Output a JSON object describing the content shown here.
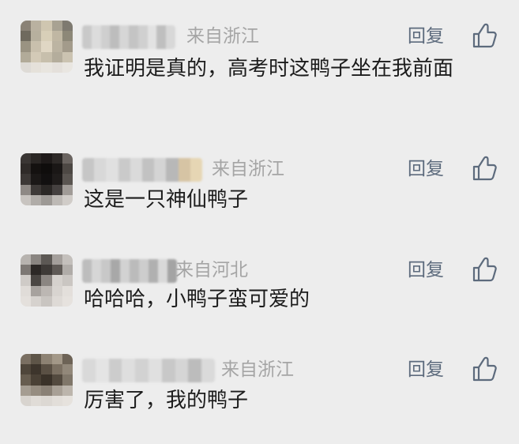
{
  "comments": [
    {
      "location": "来自浙江",
      "reply_label": "回复",
      "text": "我证明是真的，高考时这鸭子坐在我前面",
      "avatar_colors": [
        "#8a8276",
        "#b9b1a0",
        "#cfc6b0",
        "#a8a292",
        "#7e7a70",
        "#6f6a5e",
        "#b7b09e",
        "#d8cfb8",
        "#c0b7a3",
        "#8d8878",
        "#9a9382",
        "#c9c0ad",
        "#e0d7c4",
        "#bcb4a2",
        "#a39b8b",
        "#b2ab99",
        "#d3cab7",
        "#c7bfac",
        "#b4ad9c",
        "#cbc3b1",
        "#dedbd6",
        "#e5e1da",
        "#e8e5df",
        "#e4e0db",
        "#e9e6e1"
      ],
      "name_colors": [
        "#c9c9c9",
        "#dcdcdc",
        "#cfcfcf",
        "#bdbdbd",
        "#d6d6d6",
        "#c4c4c4",
        "#d0d0d0",
        "#e2e2e2",
        "#bfbfbf",
        "#d8d8d8"
      ]
    },
    {
      "location": "来自浙江",
      "reply_label": "回复",
      "text": "这是一只神仙鸭子",
      "avatar_colors": [
        "#3a3634",
        "#2a2624",
        "#1e1a19",
        "#2d2927",
        "#6a6460",
        "#2f2b29",
        "#141110",
        "#0f0d0c",
        "#1a1716",
        "#4d4844",
        "#3c3836",
        "#1b1817",
        "#121010",
        "#1f1c1b",
        "#5a5551",
        "#8e8985",
        "#3e3a38",
        "#2b2826",
        "#454140",
        "#a09b97",
        "#c8c4c0",
        "#b0aca8",
        "#9d9995",
        "#bdb9b5",
        "#d0ccc8"
      ],
      "name_colors": [
        "#c6c6c6",
        "#d8d8d8",
        "#e0e0e0",
        "#cacaca",
        "#dadada",
        "#c2c2c2",
        "#d4d4d4",
        "#b8b8b8",
        "#d6c4a4",
        "#e6d6b4"
      ]
    },
    {
      "location": "来自河北",
      "reply_label": "回复",
      "text": "哈哈哈，小鸭子蛮可爱的",
      "avatar_colors": [
        "#b7b3af",
        "#8a8581",
        "#5c5854",
        "#a49f9b",
        "#c4c0bc",
        "#7d7874",
        "#2c2826",
        "#3e3a37",
        "#5f5a56",
        "#b0aca8",
        "#cfcbc7",
        "#4a4643",
        "#8b8682",
        "#d5d1cd",
        "#cac6c2",
        "#e0dcd8",
        "#a7a29e",
        "#bcb7b3",
        "#d8d4d0",
        "#e3dfdb",
        "#e4e0dc",
        "#d6d2ce",
        "#c9c5c1",
        "#dedad6",
        "#e6e2de"
      ],
      "name_colors": [
        "#bdbdbd",
        "#d6d6d6",
        "#c8c8c8",
        "#a8a8a8",
        "#d2d2d2",
        "#bbbbbb",
        "#cdcdcd",
        "#b0b0b0",
        "#d9d9d9",
        "#a4a4a4"
      ]
    },
    {
      "location": "来自浙江",
      "reply_label": "回复",
      "text": "厉害了，我的鸭子",
      "avatar_colors": [
        "#7a6f62",
        "#5e5548",
        "#8d8273",
        "#a39888",
        "#6d6356",
        "#4f463b",
        "#3d352c",
        "#5a5044",
        "#7b7062",
        "#92887a",
        "#675d50",
        "#4a4136",
        "#3a3229",
        "#534a3f",
        "#80776a",
        "#a59d92",
        "#968d81",
        "#8a8176",
        "#a8a096",
        "#bcb5ac",
        "#d8d4cf",
        "#e0dcd7",
        "#dcd8d3",
        "#e2ded9",
        "#e6e2dd"
      ],
      "name_colors": [
        "#d9d9d9",
        "#e4e4e4",
        "#cccccc",
        "#dedede",
        "#d2d2d2",
        "#e0e0e0",
        "#c8c8c8",
        "#d5d5d5",
        "#bcbcbc",
        "#dadada"
      ]
    }
  ],
  "icons": {
    "like": "thumbs-up-icon"
  },
  "colors": {
    "background": "#ededed",
    "location": "#a5a5a5",
    "reply": "#5d6b7d",
    "text": "#1c1c1c"
  }
}
